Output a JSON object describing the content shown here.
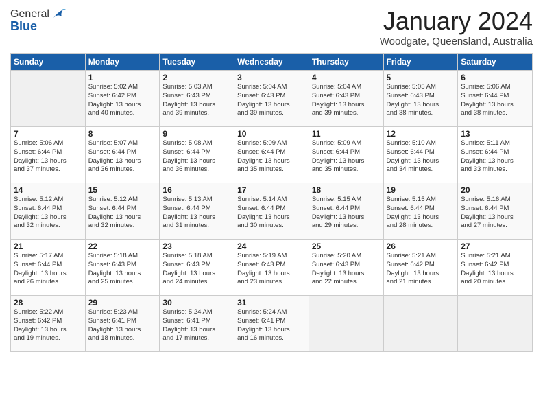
{
  "logo": {
    "general": "General",
    "blue": "Blue"
  },
  "title": "January 2024",
  "location": "Woodgate, Queensland, Australia",
  "days_of_week": [
    "Sunday",
    "Monday",
    "Tuesday",
    "Wednesday",
    "Thursday",
    "Friday",
    "Saturday"
  ],
  "weeks": [
    [
      {
        "day": "",
        "info": ""
      },
      {
        "day": "1",
        "info": "Sunrise: 5:02 AM\nSunset: 6:42 PM\nDaylight: 13 hours\nand 40 minutes."
      },
      {
        "day": "2",
        "info": "Sunrise: 5:03 AM\nSunset: 6:43 PM\nDaylight: 13 hours\nand 39 minutes."
      },
      {
        "day": "3",
        "info": "Sunrise: 5:04 AM\nSunset: 6:43 PM\nDaylight: 13 hours\nand 39 minutes."
      },
      {
        "day": "4",
        "info": "Sunrise: 5:04 AM\nSunset: 6:43 PM\nDaylight: 13 hours\nand 39 minutes."
      },
      {
        "day": "5",
        "info": "Sunrise: 5:05 AM\nSunset: 6:43 PM\nDaylight: 13 hours\nand 38 minutes."
      },
      {
        "day": "6",
        "info": "Sunrise: 5:06 AM\nSunset: 6:44 PM\nDaylight: 13 hours\nand 38 minutes."
      }
    ],
    [
      {
        "day": "7",
        "info": "Sunrise: 5:06 AM\nSunset: 6:44 PM\nDaylight: 13 hours\nand 37 minutes."
      },
      {
        "day": "8",
        "info": "Sunrise: 5:07 AM\nSunset: 6:44 PM\nDaylight: 13 hours\nand 36 minutes."
      },
      {
        "day": "9",
        "info": "Sunrise: 5:08 AM\nSunset: 6:44 PM\nDaylight: 13 hours\nand 36 minutes."
      },
      {
        "day": "10",
        "info": "Sunrise: 5:09 AM\nSunset: 6:44 PM\nDaylight: 13 hours\nand 35 minutes."
      },
      {
        "day": "11",
        "info": "Sunrise: 5:09 AM\nSunset: 6:44 PM\nDaylight: 13 hours\nand 35 minutes."
      },
      {
        "day": "12",
        "info": "Sunrise: 5:10 AM\nSunset: 6:44 PM\nDaylight: 13 hours\nand 34 minutes."
      },
      {
        "day": "13",
        "info": "Sunrise: 5:11 AM\nSunset: 6:44 PM\nDaylight: 13 hours\nand 33 minutes."
      }
    ],
    [
      {
        "day": "14",
        "info": "Sunrise: 5:12 AM\nSunset: 6:44 PM\nDaylight: 13 hours\nand 32 minutes."
      },
      {
        "day": "15",
        "info": "Sunrise: 5:12 AM\nSunset: 6:44 PM\nDaylight: 13 hours\nand 32 minutes."
      },
      {
        "day": "16",
        "info": "Sunrise: 5:13 AM\nSunset: 6:44 PM\nDaylight: 13 hours\nand 31 minutes."
      },
      {
        "day": "17",
        "info": "Sunrise: 5:14 AM\nSunset: 6:44 PM\nDaylight: 13 hours\nand 30 minutes."
      },
      {
        "day": "18",
        "info": "Sunrise: 5:15 AM\nSunset: 6:44 PM\nDaylight: 13 hours\nand 29 minutes."
      },
      {
        "day": "19",
        "info": "Sunrise: 5:15 AM\nSunset: 6:44 PM\nDaylight: 13 hours\nand 28 minutes."
      },
      {
        "day": "20",
        "info": "Sunrise: 5:16 AM\nSunset: 6:44 PM\nDaylight: 13 hours\nand 27 minutes."
      }
    ],
    [
      {
        "day": "21",
        "info": "Sunrise: 5:17 AM\nSunset: 6:44 PM\nDaylight: 13 hours\nand 26 minutes."
      },
      {
        "day": "22",
        "info": "Sunrise: 5:18 AM\nSunset: 6:43 PM\nDaylight: 13 hours\nand 25 minutes."
      },
      {
        "day": "23",
        "info": "Sunrise: 5:18 AM\nSunset: 6:43 PM\nDaylight: 13 hours\nand 24 minutes."
      },
      {
        "day": "24",
        "info": "Sunrise: 5:19 AM\nSunset: 6:43 PM\nDaylight: 13 hours\nand 23 minutes."
      },
      {
        "day": "25",
        "info": "Sunrise: 5:20 AM\nSunset: 6:43 PM\nDaylight: 13 hours\nand 22 minutes."
      },
      {
        "day": "26",
        "info": "Sunrise: 5:21 AM\nSunset: 6:42 PM\nDaylight: 13 hours\nand 21 minutes."
      },
      {
        "day": "27",
        "info": "Sunrise: 5:21 AM\nSunset: 6:42 PM\nDaylight: 13 hours\nand 20 minutes."
      }
    ],
    [
      {
        "day": "28",
        "info": "Sunrise: 5:22 AM\nSunset: 6:42 PM\nDaylight: 13 hours\nand 19 minutes."
      },
      {
        "day": "29",
        "info": "Sunrise: 5:23 AM\nSunset: 6:41 PM\nDaylight: 13 hours\nand 18 minutes."
      },
      {
        "day": "30",
        "info": "Sunrise: 5:24 AM\nSunset: 6:41 PM\nDaylight: 13 hours\nand 17 minutes."
      },
      {
        "day": "31",
        "info": "Sunrise: 5:24 AM\nSunset: 6:41 PM\nDaylight: 13 hours\nand 16 minutes."
      },
      {
        "day": "",
        "info": ""
      },
      {
        "day": "",
        "info": ""
      },
      {
        "day": "",
        "info": ""
      }
    ]
  ]
}
